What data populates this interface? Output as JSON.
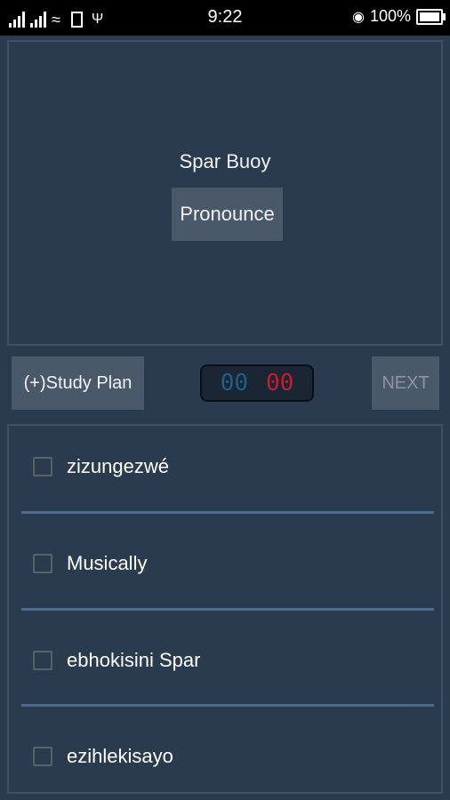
{
  "status_bar": {
    "sim1_label": "",
    "sim2_label": "",
    "time": "9:22",
    "battery": "100%",
    "icons": [
      "signal-icon",
      "signal-icon",
      "wifi-icon",
      "sim-card-icon",
      "usb-icon",
      "headset-icon",
      "battery-icon"
    ]
  },
  "card": {
    "word": "Spar Buoy",
    "pronounce_label": "Pronounce"
  },
  "controls": {
    "study_plan_label": "(+)Study Plan",
    "timer_minutes": "00",
    "timer_seconds": "00",
    "next_label": "NEXT"
  },
  "options": [
    {
      "label": "zizungezwé",
      "checked": false
    },
    {
      "label": "Musically",
      "checked": false
    },
    {
      "label": "ebhokisini Spar",
      "checked": false
    },
    {
      "label": "ezihlekisayo",
      "checked": false
    }
  ],
  "colors": {
    "background": "#2b3b4e",
    "button": "#4a5969",
    "divider": "#4c6c92",
    "timer_minutes": "#1e5f8c",
    "timer_seconds": "#c51e2e"
  }
}
